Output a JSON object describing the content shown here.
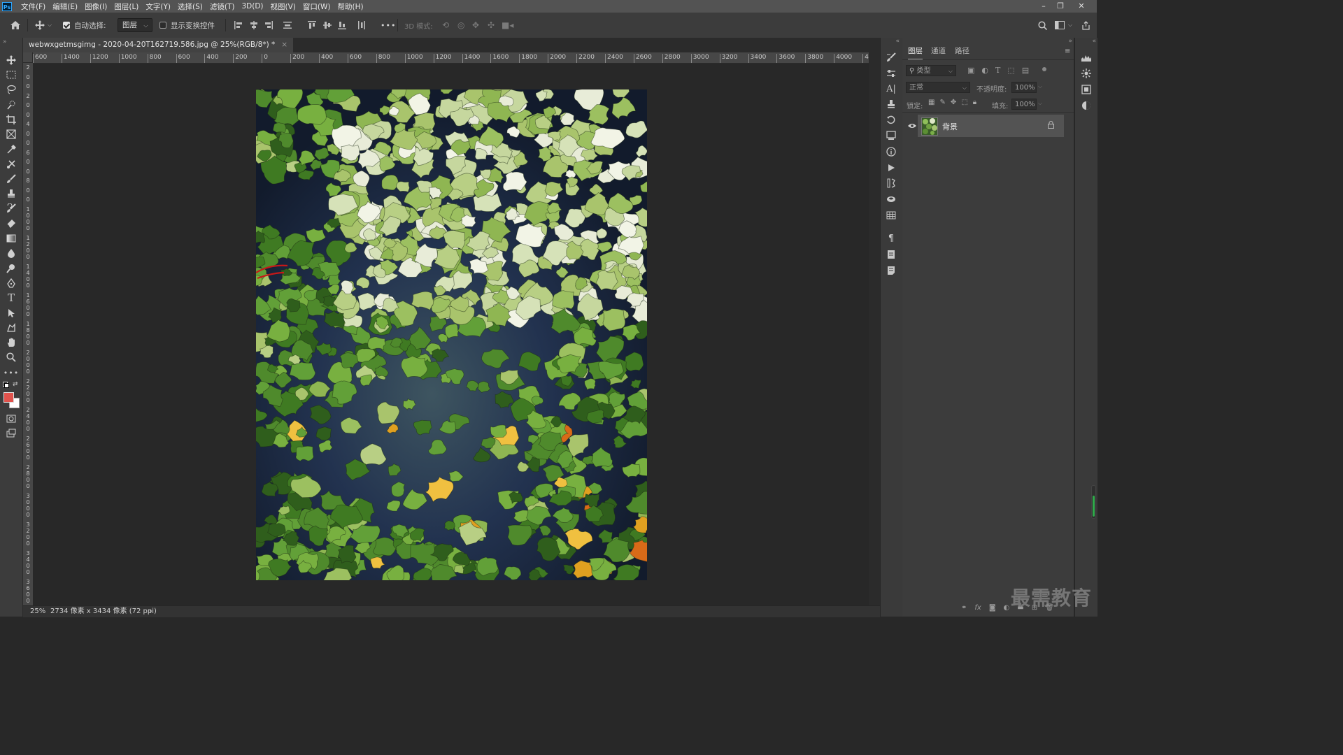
{
  "menu": {
    "logo": "Ps",
    "items": [
      "文件(F)",
      "编辑(E)",
      "图像(I)",
      "图层(L)",
      "文字(Y)",
      "选择(S)",
      "滤镜(T)",
      "3D(D)",
      "视图(V)",
      "窗口(W)",
      "帮助(H)"
    ],
    "window_controls": {
      "minimize": "–",
      "restore": "❐",
      "close": "✕"
    }
  },
  "options": {
    "auto_select_label": "自动选择:",
    "auto_select_checked": true,
    "auto_select_target": "图层",
    "show_transform_label": "显示变换控件",
    "show_transform_checked": false,
    "more": "•••",
    "mode_3d_label": "3D 模式:"
  },
  "document": {
    "tab_title": "webwxgetmsgimg - 2020-04-20T162719.586.jpg @ 25%(RGB/8*) *",
    "close": "×",
    "zoom": "25%",
    "info": "2734 像素 x 3434 像素 (72 ppi)",
    "info_arrow": "›"
  },
  "rulers": {
    "horizontal": [
      "600",
      "1400",
      "1200",
      "1000",
      "800",
      "600",
      "400",
      "200",
      "0",
      "200",
      "400",
      "600",
      "800",
      "1000",
      "1200",
      "1400",
      "1600",
      "1800",
      "2000",
      "2200",
      "2400",
      "2600",
      "2800",
      "3000",
      "3200",
      "3400",
      "3600",
      "3800",
      "4000",
      "420"
    ],
    "vertical": [
      "2",
      "0",
      "0",
      "2",
      "0",
      "0",
      "4",
      "0",
      "0",
      "6",
      "0",
      "0",
      "8",
      "0",
      "0",
      "1 0 0 0",
      "1 2 0 0",
      "1 4 0 0",
      "1 6 0 0",
      "1 8 0 0",
      "2 0 0 0",
      "2 2 0 0",
      "2 4 0 0",
      "2 6 0 0",
      "2 8 0 0",
      "3 0 0 0",
      "3 2 0 0",
      "3 4 0 0",
      "3 6 0 0"
    ]
  },
  "layers_panel": {
    "tabs": [
      "图层",
      "通道",
      "路径"
    ],
    "active_tab": 0,
    "filter_kind": "类型",
    "blend_mode": "正常",
    "opacity_label": "不透明度:",
    "opacity_value": "100%",
    "lock_label": "锁定:",
    "fill_label": "填充:",
    "fill_value": "100%",
    "layers": [
      {
        "name": "背景",
        "visible": true,
        "locked": true
      }
    ]
  },
  "colors": {
    "foreground": "#e0524c",
    "background": "#ffffff",
    "accent": "#31a8ff"
  },
  "watermark": "最需教育"
}
